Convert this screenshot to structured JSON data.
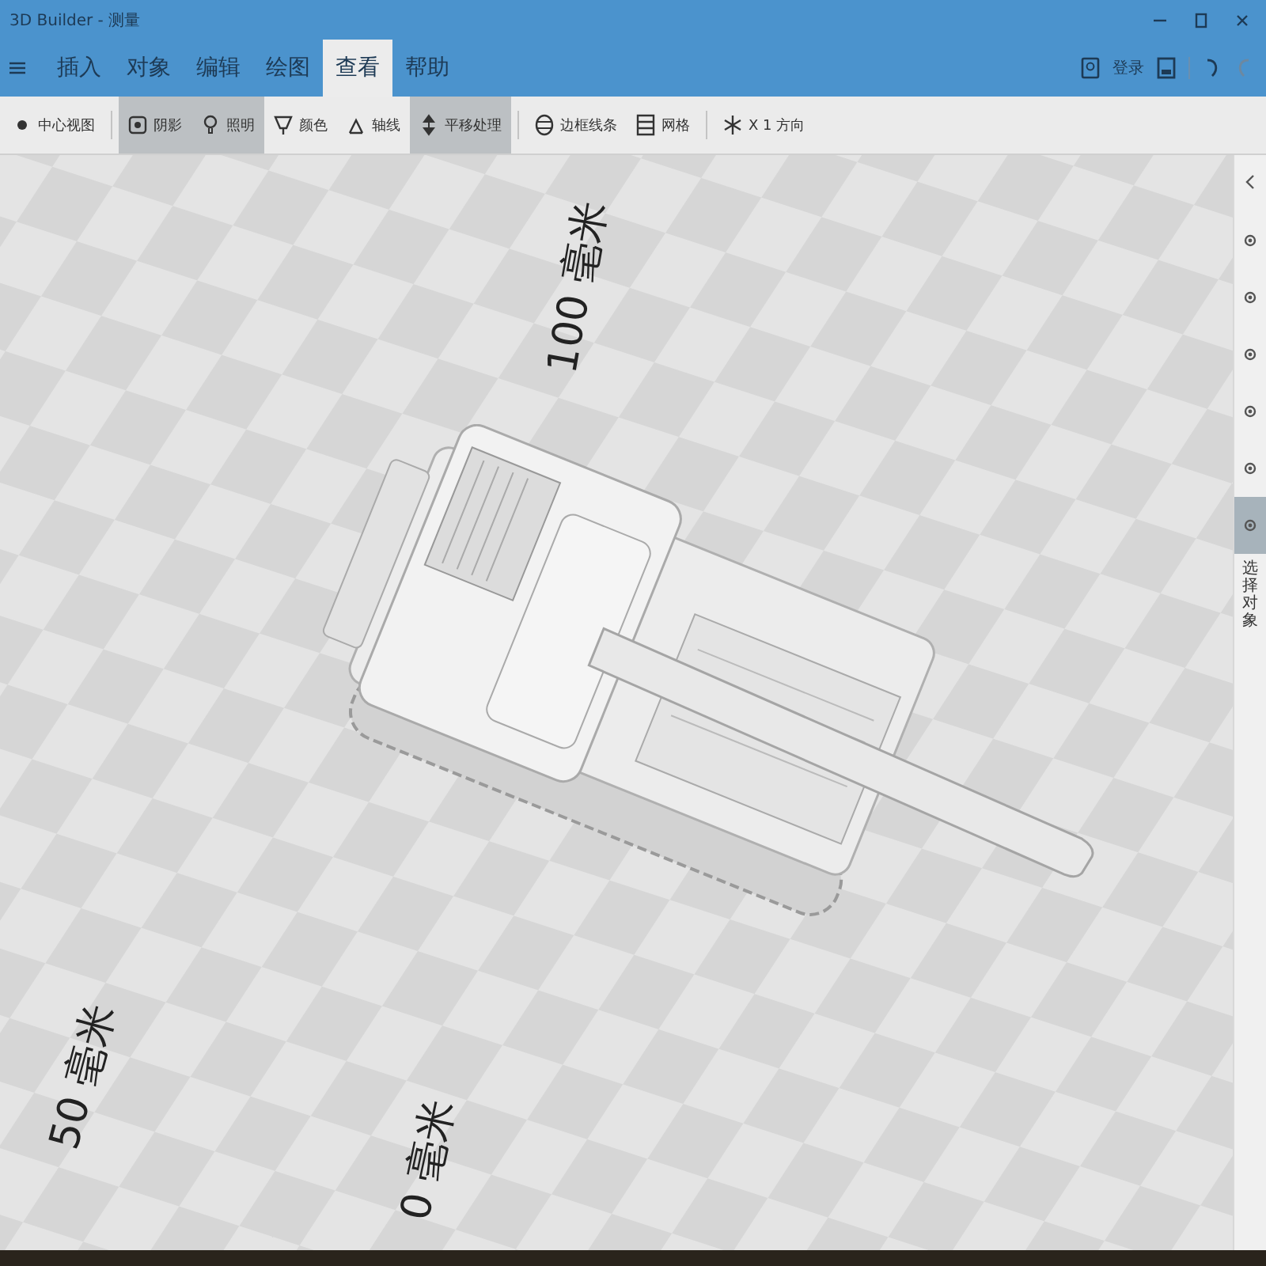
{
  "window": {
    "title": "3D Builder - 测量"
  },
  "menu": {
    "tabs": [
      {
        "label": "插入",
        "selected": false
      },
      {
        "label": "对象",
        "selected": false
      },
      {
        "label": "编辑",
        "selected": false
      },
      {
        "label": "绘图",
        "selected": false
      },
      {
        "label": "查看",
        "selected": true
      },
      {
        "label": "帮助",
        "selected": false
      }
    ],
    "account": "登录"
  },
  "toolbar": [
    {
      "kind": "center",
      "label": "中心视图",
      "selected": false,
      "separator_before": false
    },
    {
      "kind": "shadow",
      "label": "阴影",
      "selected": true,
      "separator_before": true
    },
    {
      "kind": "light",
      "label": "照明",
      "selected": true,
      "separator_before": false
    },
    {
      "kind": "color",
      "label": "颜色",
      "selected": false,
      "separator_before": false
    },
    {
      "kind": "axis",
      "label": "轴线",
      "selected": false,
      "separator_before": false
    },
    {
      "kind": "pan",
      "label": "平移处理",
      "selected": true,
      "separator_before": false
    },
    {
      "kind": "frame",
      "label": "边框线条",
      "selected": false,
      "separator_before": true
    },
    {
      "kind": "grid",
      "label": "网格",
      "selected": false,
      "separator_before": false
    },
    {
      "kind": "star",
      "label": "X 1 方向",
      "selected": false,
      "separator_before": true
    }
  ],
  "canvas": {
    "rulers": [
      "100 毫米",
      "50 毫米",
      "0 毫米"
    ]
  },
  "side_panel": {
    "items": [
      {
        "selected": false
      },
      {
        "selected": false
      },
      {
        "selected": false
      },
      {
        "selected": false
      },
      {
        "selected": false
      },
      {
        "selected": true
      }
    ],
    "label": "选择对象"
  }
}
